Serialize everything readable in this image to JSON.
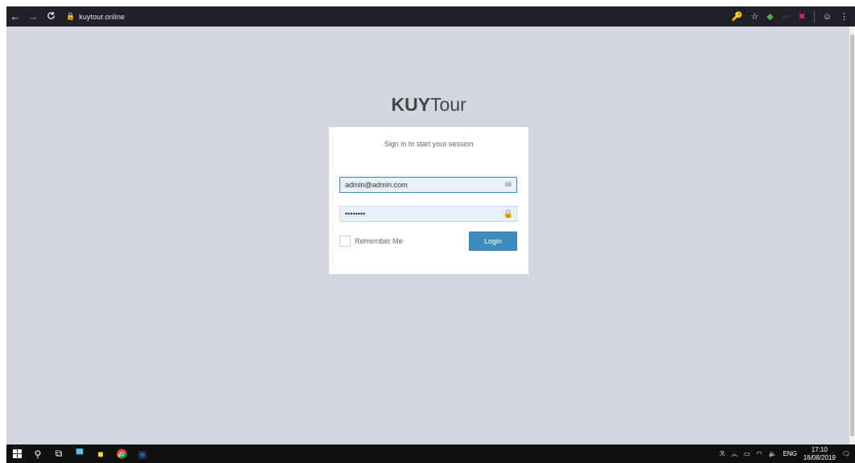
{
  "browser": {
    "url": "kuytour.online",
    "icons": {
      "back": "back-arrow-icon",
      "forward": "forward-arrow-icon",
      "reload": "reload-icon",
      "lock": "lock-icon"
    }
  },
  "login": {
    "logo_bold": "KUY",
    "logo_light": "Tour",
    "message": "Sign in to start your session",
    "email_value": "admin@admin.com",
    "password_value": "••••••••",
    "remember_label": "Remember Me",
    "login_label": "Login"
  },
  "taskbar": {
    "language": "ENG",
    "time": "17:10",
    "date": "16/08/2019"
  },
  "colors": {
    "page_bg": "#d2d6de",
    "primary_button": "#3c8dbc",
    "browser_bar": "#202124",
    "taskbar": "#101010"
  }
}
